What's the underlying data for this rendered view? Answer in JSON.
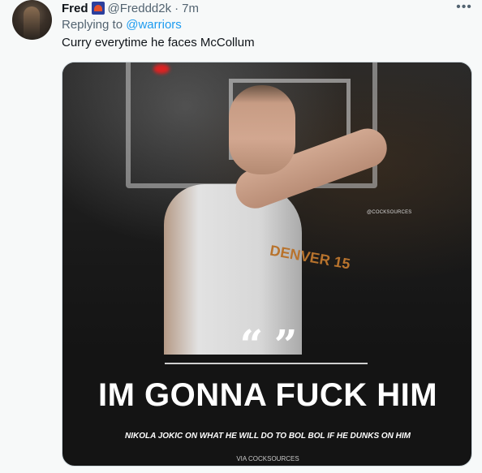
{
  "tweet": {
    "author": {
      "name": "Fred",
      "handle": "@Freddd2k",
      "separator": "·",
      "time": "7m",
      "badge_icon": "team-logo-icon"
    },
    "more_label": "•••",
    "reply": {
      "prefix": "Replying to",
      "mention": "@warriors"
    },
    "text": "Curry everytime he faces McCollum",
    "media": {
      "jersey_text": "DENVER 15",
      "watermark": "@COCKSOURCES",
      "quote_mark": "“ ”",
      "headline": "IM GONNA FUCK HIM",
      "caption": "NIKOLA JOKIC ON WHAT HE WILL DO TO BOL BOL IF HE DUNKS ON HIM",
      "credit": "VIA COCKSOURCES"
    }
  },
  "colors": {
    "link": "#1d9bf0",
    "secondary_text": "#536471",
    "primary_text": "#0f1419",
    "background": "#f7f9f9"
  }
}
